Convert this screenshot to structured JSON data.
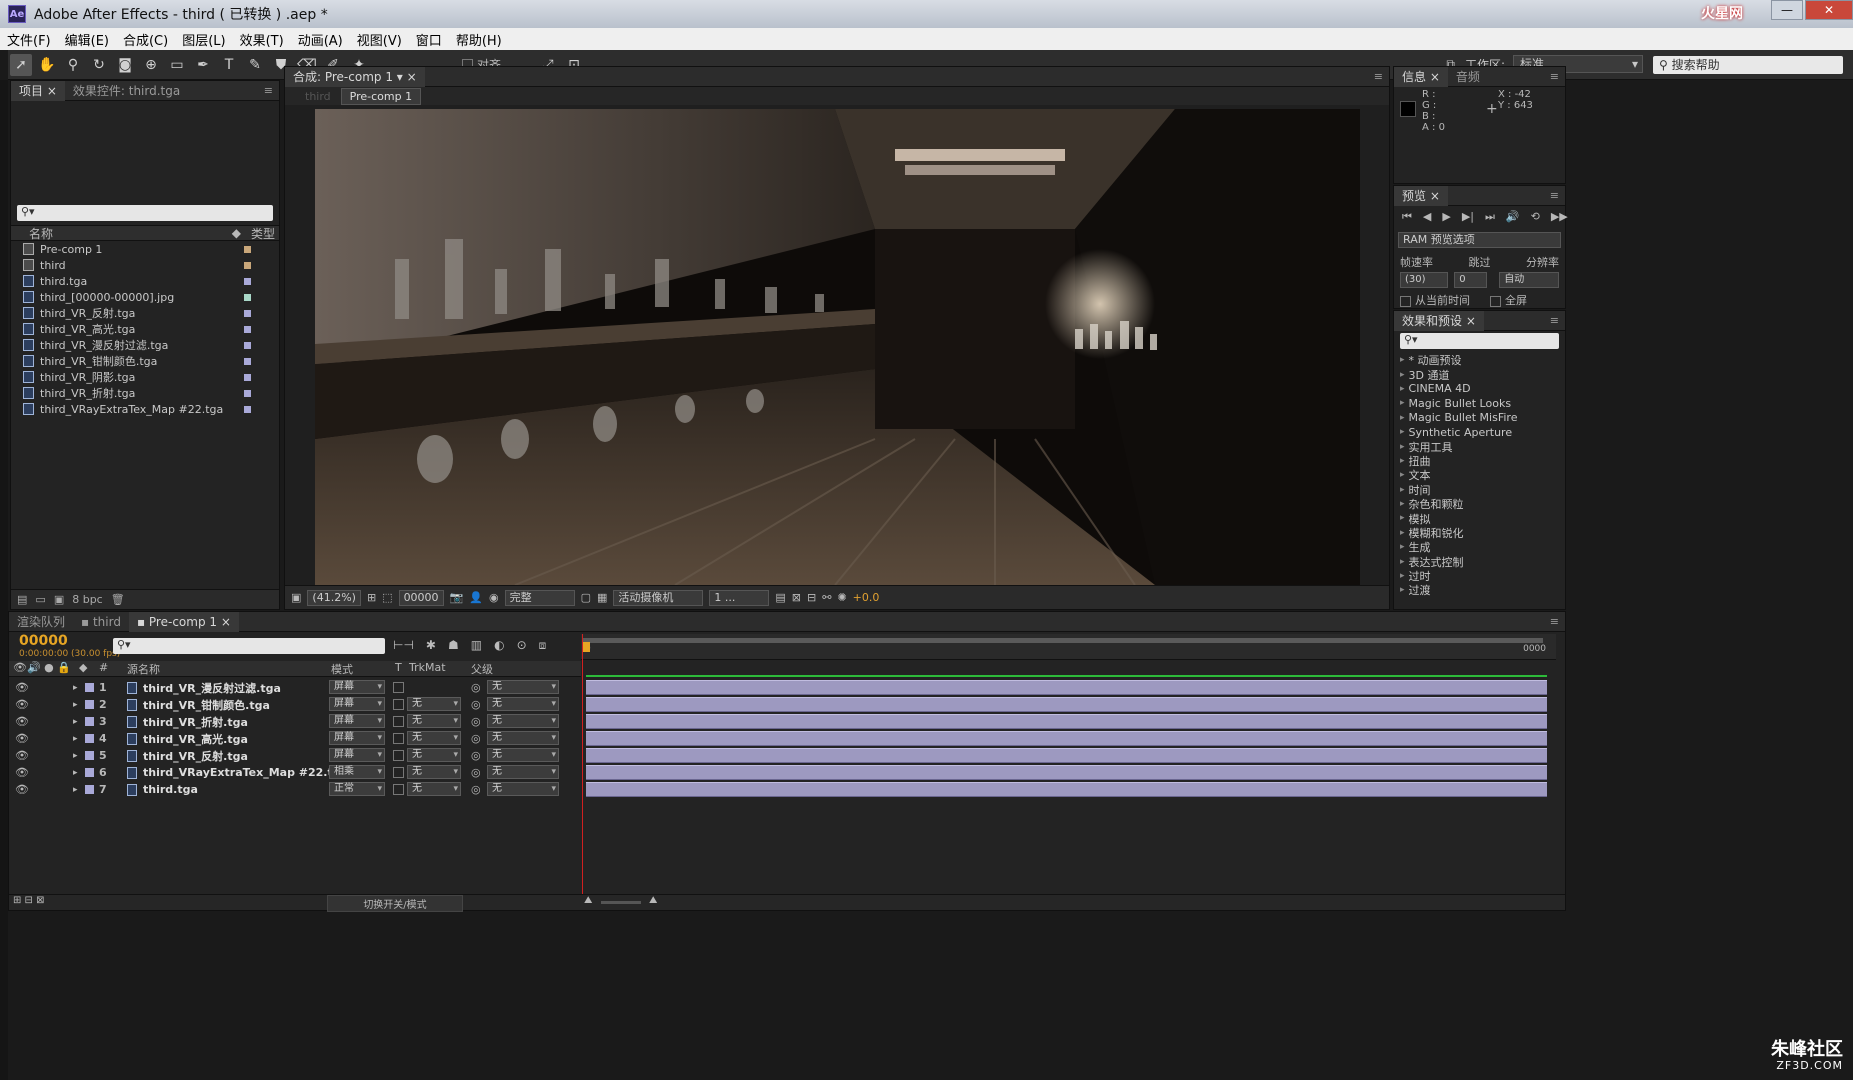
{
  "window": {
    "title": "Adobe After Effects - third ( 已转换 ) .aep *",
    "app_icon": "Ae",
    "brand": "火星网"
  },
  "menu": [
    "文件(F)",
    "编辑(E)",
    "合成(C)",
    "图层(L)",
    "效果(T)",
    "动画(A)",
    "视图(V)",
    "窗口",
    "帮助(H)"
  ],
  "toolbar": {
    "align_label": "对齐",
    "workspace_label": "工作区:",
    "workspace_value": "标准",
    "help_placeholder": "搜索帮助"
  },
  "project": {
    "tabs": [
      "项目",
      "效果控件: third.tga"
    ],
    "col_name": "名称",
    "col_type": "类型",
    "items": [
      {
        "name": "Pre-comp 1",
        "kind": "comp",
        "color": "#c9a77a"
      },
      {
        "name": "third",
        "kind": "comp",
        "color": "#c9a77a"
      },
      {
        "name": "third.tga",
        "kind": "file",
        "color": "#a9a9d8"
      },
      {
        "name": "third_[00000-00000].jpg",
        "kind": "file",
        "color": "#a9d8c8"
      },
      {
        "name": "third_VR_反射.tga",
        "kind": "file",
        "color": "#a9a9d8"
      },
      {
        "name": "third_VR_高光.tga",
        "kind": "file",
        "color": "#a9a9d8"
      },
      {
        "name": "third_VR_漫反射过滤.tga",
        "kind": "file",
        "color": "#a9a9d8"
      },
      {
        "name": "third_VR_钳制颜色.tga",
        "kind": "file",
        "color": "#a9a9d8"
      },
      {
        "name": "third_VR_阴影.tga",
        "kind": "file",
        "color": "#a9a9d8"
      },
      {
        "name": "third_VR_折射.tga",
        "kind": "file",
        "color": "#a9a9d8"
      },
      {
        "name": "third_VRayExtraTex_Map #22.tga",
        "kind": "file",
        "color": "#a9a9d8"
      }
    ],
    "bpc": "8 bpc"
  },
  "comp": {
    "tab": "合成: Pre-comp 1",
    "crumbs": [
      "third",
      "Pre-comp 1"
    ],
    "zoom": "(41.2%)",
    "timecode": "00000",
    "quality": "完整",
    "camera": "活动摄像机",
    "views": "1 ...",
    "exposure": "+0.0"
  },
  "info": {
    "tabs": [
      "信息",
      "音频"
    ],
    "r": "R :",
    "g": "G :",
    "b": "B :",
    "a": "A : 0",
    "x": "X : -42",
    "y": "Y : 643"
  },
  "preview": {
    "tab": "预览",
    "ram_option": "RAM 预览选项",
    "fps_label": "帧速率",
    "skip_label": "跳过",
    "res_label": "分辨率",
    "fps": "(30)",
    "skip": "0",
    "res": "自动",
    "from_current": "从当前时间",
    "fullscreen": "全屏"
  },
  "effects": {
    "tab": "效果和预设",
    "items": [
      "* 动画预设",
      "3D 通道",
      "CINEMA 4D",
      "Magic Bullet Looks",
      "Magic Bullet MisFire",
      "Synthetic Aperture",
      "实用工具",
      "扭曲",
      "文本",
      "时间",
      "杂色和颗粒",
      "模拟",
      "模糊和锐化",
      "生成",
      "表达式控制",
      "过时",
      "过渡"
    ]
  },
  "timeline": {
    "tabs": [
      "渲染队列",
      "third",
      "Pre-comp 1"
    ],
    "timecode": "00000",
    "timecode_sub": "0:00:00:00 (30.00 fps)",
    "col_num": "#",
    "col_source": "源名称",
    "col_mode": "模式",
    "col_t": "T",
    "col_trkmat": "TrkMat",
    "col_parent": "父级",
    "ruler_start": "0",
    "ruler_end": "0000",
    "layers": [
      {
        "num": "1",
        "name": "third_VR_漫反射过滤.tga",
        "mode": "屏幕",
        "trkmat": "",
        "parent": "无"
      },
      {
        "num": "2",
        "name": "third_VR_钳制颜色.tga",
        "mode": "屏幕",
        "trkmat": "无",
        "parent": "无"
      },
      {
        "num": "3",
        "name": "third_VR_折射.tga",
        "mode": "屏幕",
        "trkmat": "无",
        "parent": "无"
      },
      {
        "num": "4",
        "name": "third_VR_高光.tga",
        "mode": "屏幕",
        "trkmat": "无",
        "parent": "无"
      },
      {
        "num": "5",
        "name": "third_VR_反射.tga",
        "mode": "屏幕",
        "trkmat": "无",
        "parent": "无"
      },
      {
        "num": "6",
        "name": "third_VRayExtraTex_Map #22.tga",
        "mode": "相乘",
        "trkmat": "无",
        "parent": "无"
      },
      {
        "num": "7",
        "name": "third.tga",
        "mode": "正常",
        "trkmat": "无",
        "parent": "无"
      }
    ],
    "toggle_label": "切换开关/模式"
  },
  "watermark": {
    "line1": "朱峰社区",
    "line2": "ZF3D.COM"
  }
}
